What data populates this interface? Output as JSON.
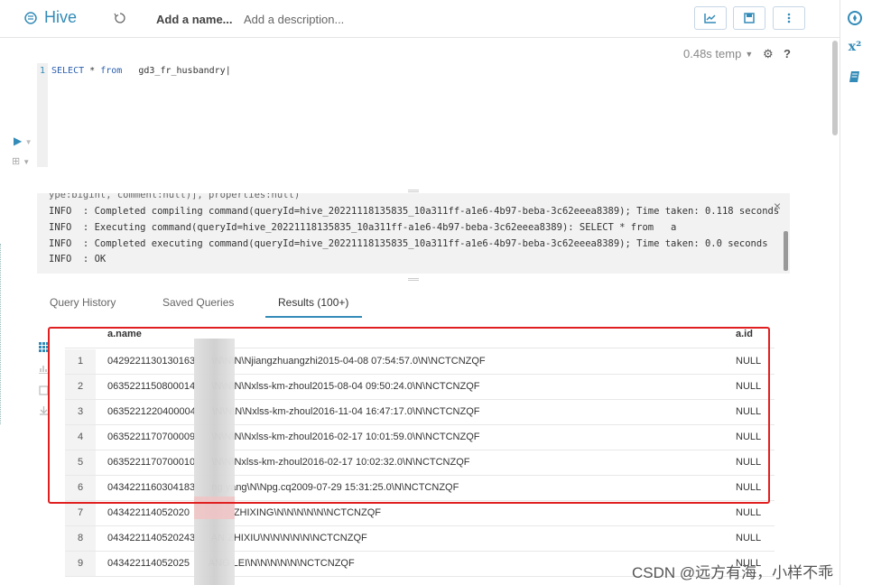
{
  "header": {
    "app_name": "Hive",
    "query_name": "Add a name...",
    "query_description": "Add a description..."
  },
  "editor": {
    "execution_time": "0.48s temp",
    "line_number": "1",
    "code_keyword1": "SELECT",
    "code_op": "*",
    "code_keyword2": "from",
    "code_table": "gd3_fr_husbandry"
  },
  "log": {
    "partial_line": "ype:bigint, comment:null)], properties:null)",
    "lines": [
      "INFO  : Completed compiling command(queryId=hive_20221118135835_10a311ff-a1e6-4b97-beba-3c62eeea8389); Time taken: 0.118 seconds",
      "INFO  : Executing command(queryId=hive_20221118135835_10a311ff-a1e6-4b97-beba-3c62eeea8389): SELECT * from   a",
      "INFO  : Completed executing command(queryId=hive_20221118135835_10a311ff-a1e6-4b97-beba-3c62eeea8389); Time taken: 0.0 seconds",
      "INFO  : OK"
    ]
  },
  "tabs": [
    "Query History",
    "Saved Queries",
    "Results (100+)"
  ],
  "results": {
    "columns": [
      "a.name",
      "a.id"
    ],
    "rows": [
      {
        "num": "1",
        "name": "0429221130130163      \\N\u0001\\N\u0001\\N\u0001\\N\u0001jiangzhuangzhi\u00012015-04-08 07:54:57.0\u0001\\N\u0001\\N\u0001CTCNZQF",
        "id": "NULL"
      },
      {
        "num": "2",
        "name": "0635221150800014      \\N\u0001\\N\u0001\\N\u0001\\N\u0001xlss-km-zhoul\u00012015-08-04 09:50:24.0\u0001\\N\u0001\\N\u0001CTCNZQF",
        "id": "NULL"
      },
      {
        "num": "3",
        "name": "0635221220400004      \\N\u0001\\N\u0001\\N\u0001\\N\u0001xlss-km-zhoul\u00012016-11-04 16:47:17.0\u0001\\N\u0001\\N\u0001CTCNZQF",
        "id": "NULL"
      },
      {
        "num": "4",
        "name": "0635221170700009      \\N\u0001\\N\u0001\\N\u0001\\N\u0001xlss-km-zhoul\u00012016-02-17 10:01:59.0\u0001\\N\u0001\\N\u0001CTCNZQF",
        "id": "NULL"
      },
      {
        "num": "5",
        "name": "0635221170700010      \\N\u0001\\N\u0001\\N\u0001xlss-km-zhoul\u00012016-02-17 10:02:32.0\u0001\\N\u0001\\N\u0001CTCNZQF",
        "id": "NULL"
      },
      {
        "num": "6",
        "name": "0434221160304183      ng yang\u0001\\N\u0001\\N\u0001pg.cq\u00012009-07-29 15:31:25.0\u0001\\N\u0001\\N\u0001CTCNZQF",
        "id": "NULL"
      },
      {
        "num": "7",
        "name": "043422114052020       HOU ZHIXING\u0001\\N\u0001\\N\u0001\\N\u0001\\N\u0001\\N\u0001\\N\u0001CTCNZQF",
        "id": "NULL"
      },
      {
        "num": "8",
        "name": "0434221140520243      AN ZHIXIU\u0001\\N\u0001\\N\u0001\\N\u0001\\N\u0001\\N\u0001\\N\u0001CTCNZQF",
        "id": "NULL"
      },
      {
        "num": "9",
        "name": "043422114052025       ANG LEI\u0001\\N\u0001\\N\u0001\\N\u0001\\N\u0001\\N\u0001\\N\u0001CTCNZQF",
        "id": "NULL"
      }
    ]
  },
  "watermark": "CSDN @远方有海，小样不乖"
}
